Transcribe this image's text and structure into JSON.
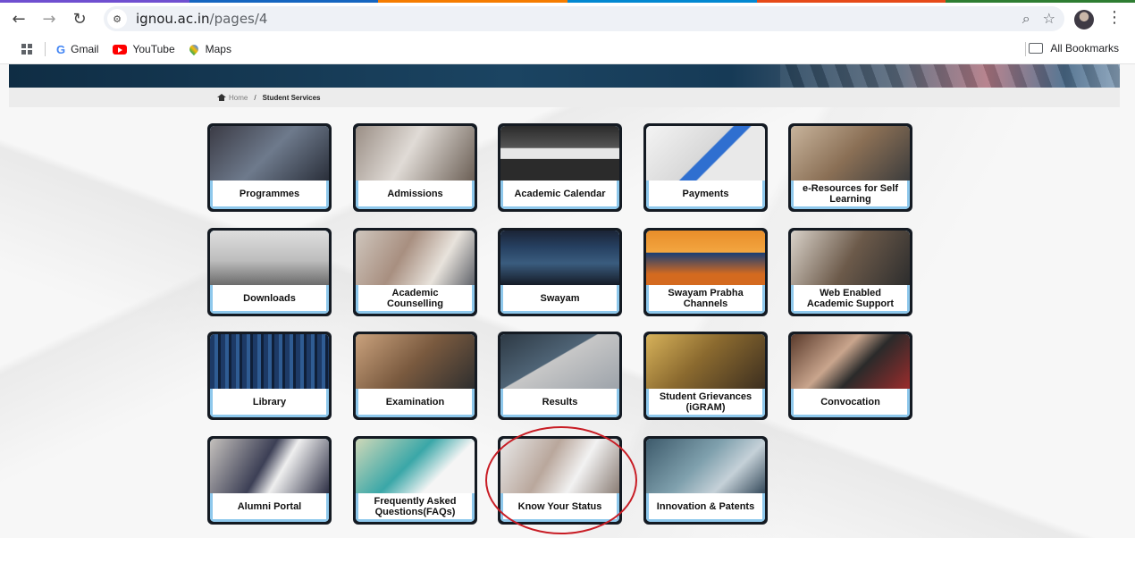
{
  "browser": {
    "url_host": "ignou.ac.in",
    "url_path": "/pages/4",
    "strip_colors": [
      "#6f4fd0",
      "#1565c0",
      "#f57c00",
      "#0288d1",
      "#e64a19",
      "#2e7d32"
    ],
    "bookmarks": [
      {
        "label": "Gmail",
        "icon": "gmail-icon"
      },
      {
        "label": "YouTube",
        "icon": "youtube-icon"
      },
      {
        "label": "Maps",
        "icon": "maps-icon"
      }
    ],
    "all_bookmarks_label": "All Bookmarks"
  },
  "breadcrumb": {
    "home_label": "Home",
    "separator": "/",
    "current": "Student Services"
  },
  "tiles": [
    {
      "label": "Programmes"
    },
    {
      "label": "Admissions"
    },
    {
      "label": "Academic Calendar"
    },
    {
      "label": "Payments"
    },
    {
      "label": "e-Resources for Self Learning"
    },
    {
      "label": "Downloads"
    },
    {
      "label": "Academic Counselling"
    },
    {
      "label": "Swayam"
    },
    {
      "label": "Swayam Prabha Channels"
    },
    {
      "label": "Web Enabled Academic Support"
    },
    {
      "label": "Library"
    },
    {
      "label": "Examination"
    },
    {
      "label": "Results"
    },
    {
      "label": "Student Grievances (iGRAM)"
    },
    {
      "label": "Convocation"
    },
    {
      "label": "Alumni Portal"
    },
    {
      "label": "Frequently Asked Questions(FAQs)"
    },
    {
      "label": "Know Your Status"
    },
    {
      "label": "Innovation & Patents"
    }
  ],
  "colors": {
    "tile_border": "#8ec8ec",
    "tile_frame": "#141a22",
    "highlight_ring": "#c81d25"
  }
}
